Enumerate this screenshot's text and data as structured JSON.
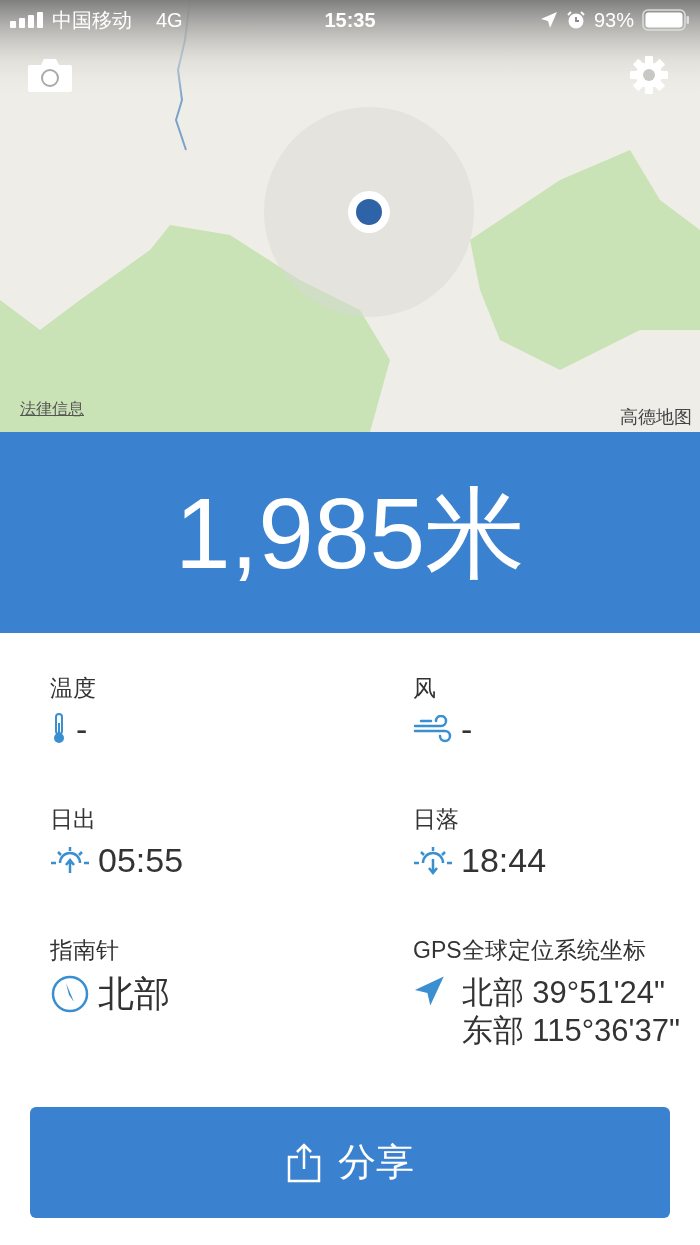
{
  "status_bar": {
    "carrier": "中国移动",
    "network": "4G",
    "time": "15:35",
    "battery": "93%"
  },
  "map": {
    "kind": "picture",
    "legal_link": "法律信息",
    "attribution": "高德地图"
  },
  "altitude": "1,985米",
  "stats": [
    {
      "kind": "temperature",
      "label": "温度",
      "value": "-"
    },
    {
      "kind": "wind",
      "label": "风",
      "value": "-"
    },
    {
      "kind": "sunrise",
      "label": "日出",
      "value": "05:55"
    },
    {
      "kind": "sunset",
      "label": "日落",
      "value": "18:44"
    },
    {
      "kind": "compass",
      "label": "指南针",
      "value": "北部"
    },
    {
      "kind": "gps",
      "label": "GPS全球定位系统坐标",
      "lines": [
        "北部 39°51'24\"",
        "东部 115°36'37\""
      ]
    }
  ],
  "share_button": {
    "label": "分享"
  }
}
